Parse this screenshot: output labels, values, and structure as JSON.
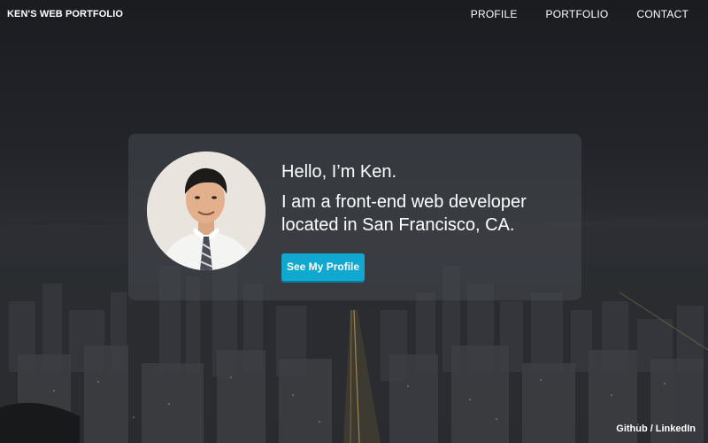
{
  "header": {
    "brand": "KEN'S WEB PORTFOLIO",
    "nav": [
      {
        "label": "PROFILE"
      },
      {
        "label": "PORTFOLIO"
      },
      {
        "label": "CONTACT"
      }
    ]
  },
  "hero": {
    "greeting": "Hello, I’m Ken.",
    "tagline": "I am a front-end web developer located in San Francisco, CA.",
    "cta_label": "See My Profile",
    "avatar_alt": "Profile photo of Ken"
  },
  "footer": {
    "links": [
      {
        "label": "Github"
      },
      {
        "label": "LinkedIn"
      }
    ],
    "separator": "/"
  },
  "colors": {
    "accent": "#10a7d0",
    "card_bg": "rgba(70,72,78,0.55)",
    "page_bg": "#1f2024"
  }
}
